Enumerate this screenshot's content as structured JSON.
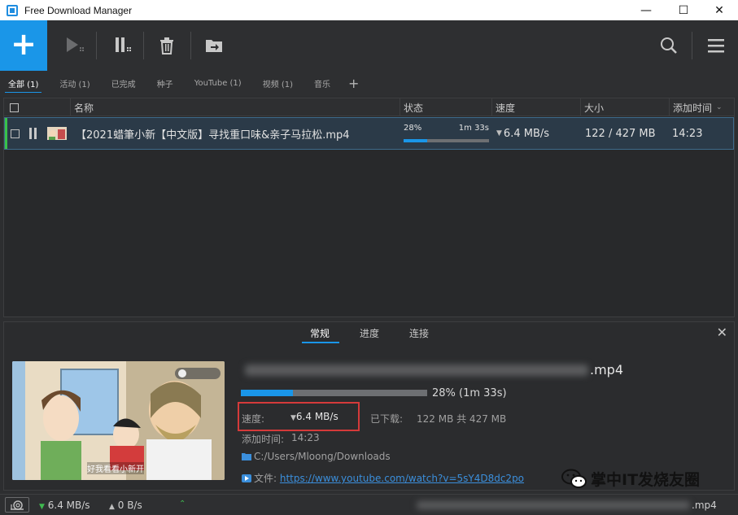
{
  "window": {
    "title": "Free Download Manager",
    "minimize": "—",
    "maximize": "☐",
    "close": "✕"
  },
  "tabs": [
    {
      "label": "全部 (1)",
      "active": true
    },
    {
      "label": "活动 (1)"
    },
    {
      "label": "已完成"
    },
    {
      "label": "种子"
    },
    {
      "label": "YouTube (1)"
    },
    {
      "label": "视频 (1)"
    },
    {
      "label": "音乐"
    }
  ],
  "columns": {
    "name": "名称",
    "status": "状态",
    "speed": "速度",
    "size": "大小",
    "added": "添加时间"
  },
  "row": {
    "name": "【2021蜡筆小新【中文版】寻找重口味&亲子马拉松.mp4",
    "percent_text": "28%",
    "eta": "1m 33s",
    "progress": 0.28,
    "speed": "6.4 MB/s",
    "size": "122 / 427 MB",
    "added": "14:23"
  },
  "details": {
    "tabs": [
      "常规",
      "进度",
      "连接"
    ],
    "file_ext": ".mp4",
    "progress": 0.28,
    "progress_text": "28% (1m 33s)",
    "speed_label": "速度:",
    "speed_value": "6.4 MB/s",
    "downloaded_label": "已下载:",
    "downloaded_value": "122 MB 共 427 MB",
    "added_label": "添加时间:",
    "added_value": "14:23",
    "folder": "C:/Users/Mloong/Downloads",
    "file_label": "文件:",
    "file_url": "https://www.youtube.com/watch?v=5sY4D8dc2po",
    "thumb_caption": "好我看看小新开"
  },
  "statusbar": {
    "down_speed": "6.4 MB/s",
    "up_speed": "0 B/s",
    "file_ext": ".mp4"
  },
  "watermark": "掌中IT发烧友圈",
  "colors": {
    "accent": "#1a96e8",
    "highlight_box": "#d53a3a",
    "active_bar": "#39c24a"
  }
}
